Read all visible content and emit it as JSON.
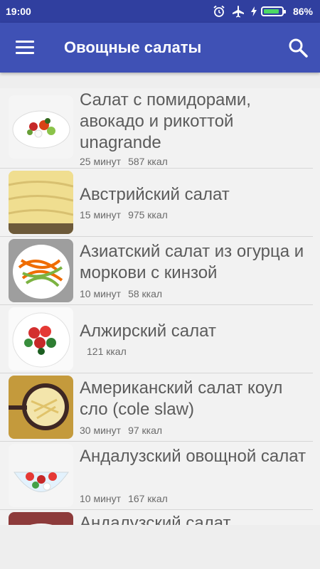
{
  "status_bar": {
    "time": "19:00",
    "battery_percent": "86%",
    "battery_level": 0.86,
    "icons": [
      "alarm-icon",
      "airplane-icon",
      "charging-icon",
      "battery-icon"
    ]
  },
  "app_bar": {
    "title": "Овощные салаты",
    "menu_icon": "menu-icon",
    "search_icon": "search-icon"
  },
  "recipes": [
    {
      "title": "Салат с помидорами, авокадо и рикоттой unagrande",
      "time": "25 минут",
      "kcal": "587 ккал"
    },
    {
      "title": "Австрийский салат",
      "time": "15 минут",
      "kcal": "975 ккал"
    },
    {
      "title": "Азиатский салат из огурца и моркови с кинзой",
      "time": "10 минут",
      "kcal": "58 ккал"
    },
    {
      "title": "Алжирский салат",
      "time": "",
      "kcal": "121 ккал"
    },
    {
      "title": "Американский салат коул сло (cole slaw)",
      "time": "30 минут",
      "kcal": "97 ккал"
    },
    {
      "title": "Андалузский овощной салат",
      "time": "10 минут",
      "kcal": "167 ккал"
    },
    {
      "title": "Андалузский салат",
      "time": "",
      "kcal": ""
    }
  ]
}
